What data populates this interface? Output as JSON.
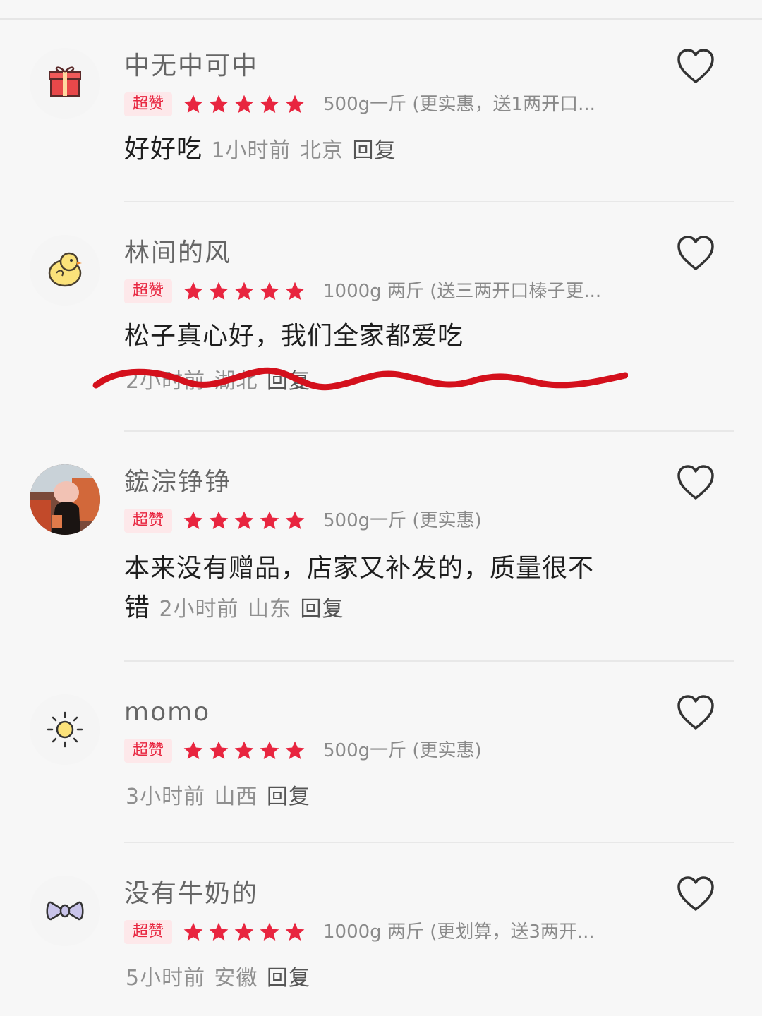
{
  "colors": {
    "accent_red": "#e8253f",
    "badge_bg": "#fde8ea",
    "scribble_red": "#d4101c"
  },
  "reviews": [
    {
      "username": "中无中可中",
      "avatar_icon": "gift-icon",
      "badge": "超赞",
      "rating": 5,
      "spec": "500g一斤 (更实惠，送1两开口...",
      "text": "好好吃",
      "time": "1小时前",
      "location": "北京",
      "reply": "回复"
    },
    {
      "username": "林间的风",
      "avatar_icon": "chick-icon",
      "badge": "超赞",
      "rating": 5,
      "spec": "1000g 两斤 (送三两开口榛子更...",
      "text": "松子真心好，我们全家都爱吃",
      "time": "2小时前",
      "location": "湖北",
      "reply": "回复"
    },
    {
      "username": "鋐淙铮铮",
      "avatar_icon": "photo-avatar",
      "badge": "超赞",
      "rating": 5,
      "spec": "500g一斤 (更实惠)",
      "text": "本来没有赠品，店家又补发的，质量很不错",
      "time": "2小时前",
      "location": "山东",
      "reply": "回复"
    },
    {
      "username": "momo",
      "avatar_icon": "sun-icon",
      "badge": "超赞",
      "rating": 5,
      "spec": "500g一斤 (更实惠)",
      "text": "",
      "time": "3小时前",
      "location": "山西",
      "reply": "回复"
    },
    {
      "username": "没有牛奶的",
      "avatar_icon": "bow-icon",
      "badge": "超赞",
      "rating": 5,
      "spec": "1000g 两斤 (更划算，送3两开...",
      "text": "",
      "time": "5小时前",
      "location": "安徽",
      "reply": "回复"
    }
  ]
}
